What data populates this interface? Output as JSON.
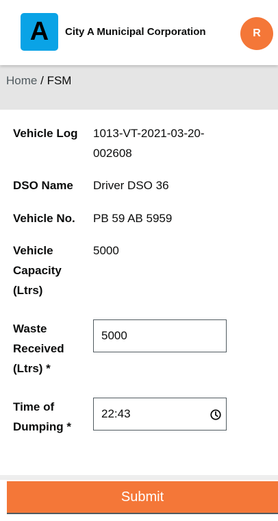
{
  "header": {
    "logo_letter": "A",
    "title": "City A Municipal Corporation",
    "avatar_initial": "R",
    "brand_color": "#f47738",
    "logo_color": "#0aa3e6"
  },
  "breadcrumb": {
    "home": "Home",
    "separator": "/",
    "current": "FSM"
  },
  "form": {
    "vehicle_log": {
      "label": "Vehicle Log",
      "value": "1013-VT-2021-03-20-002608"
    },
    "dso_name": {
      "label": "DSO Name",
      "value": "Driver DSO 36"
    },
    "vehicle_no": {
      "label": "Vehicle No.",
      "value": "PB 59 AB 5959"
    },
    "vehicle_capacity": {
      "label": "Vehicle Capacity (Ltrs)",
      "value": "5000"
    },
    "waste_received": {
      "label": "Waste Received (Ltrs) *",
      "value": "5000"
    },
    "time_of_dumping": {
      "label": "Time of Dumping *",
      "value": "22:43",
      "icon": "clock-icon"
    }
  },
  "actions": {
    "submit_label": "Submit"
  }
}
